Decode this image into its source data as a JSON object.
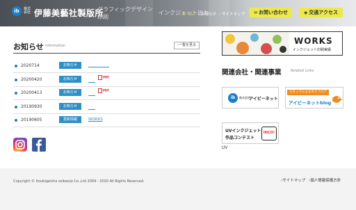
{
  "header": {
    "logo_mark": "ib",
    "logo_sub": "株式会社",
    "logo_text": "伊藤美藝社製版所",
    "tagline_1": "グラフィックデザイン",
    "tagline_2": "インクジェット出力",
    "tagline_3": "印刷",
    "nav": [
      {
        "label": "ホーム",
        "active": true
      },
      {
        "label": "お知らせ",
        "active": false
      },
      {
        "label": "サイトマップ",
        "active": false
      }
    ],
    "contact_label": "お問い合わせ",
    "access_label": "交通アクセス",
    "accent_color": "#ecea4a"
  },
  "news": {
    "title": "お知らせ",
    "subtitle": "Information",
    "more_label": "一覧を見る",
    "items": [
      {
        "date": "2020714",
        "category": "お知らせ",
        "link": "",
        "pdf": false
      },
      {
        "date": "20200420",
        "category": "お知らせ",
        "link": "",
        "pdf": true
      },
      {
        "date": "20200413",
        "category": "お知らせ",
        "link": "",
        "pdf": true
      },
      {
        "date": "20190930",
        "category": "お知らせ",
        "link": "",
        "pdf": false
      },
      {
        "date": "20190605",
        "category": "更新情報",
        "link": "WORKS",
        "pdf": false
      }
    ],
    "pdf_label": "PDF"
  },
  "social": {
    "instagram": "instagram-icon",
    "facebook": "facebook-icon"
  },
  "works_banner": {
    "title": "WORKS",
    "subtitle": "インクジェット印刷実績"
  },
  "related": {
    "title": "関連会社・関連事業",
    "subtitle": "Related Links",
    "banner1": {
      "mark": "ib",
      "small": "株式会社",
      "name": "アイビーネット"
    },
    "banner2": {
      "ribbon": "スタッフによるタクフロア",
      "name": "アイビーネットblog"
    },
    "banner3": {
      "line1": "UVインクジェット",
      "line2": "作品コンテスト",
      "badge": "INCO!"
    },
    "uv_label": "UV"
  },
  "footer": {
    "copyright": "Copyright © Itoubigeisha seibanjo Co.,Ltd 2009 - 2020 All Rights Reserved.",
    "links": [
      "サイトマップ",
      "個人情報保護方針"
    ]
  }
}
